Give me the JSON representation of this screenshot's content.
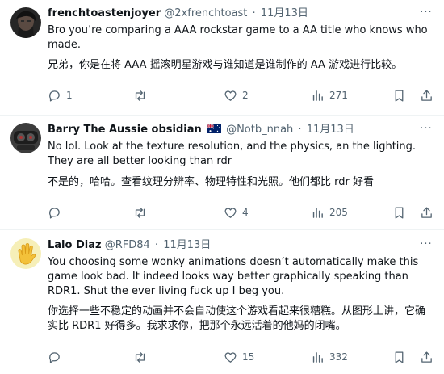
{
  "tweets": [
    {
      "name": "frenchtoastenjoyer",
      "handle": "@2xfrenchtoast",
      "separator": "·",
      "date": "11月13日",
      "more_label": "···",
      "text_en": "Bro you’re comparing a AAA rockstar game to a AA title who knows who made.",
      "text_zh": "兄弟，你是在将 AAA 摇滚明星游戏与谁知道是谁制作的 AA 游戏进行比较。",
      "replies": "1",
      "retweets": "",
      "likes": "2",
      "views": "271"
    },
    {
      "name": "Barry The Aussie obsidian",
      "flag": "australia-flag",
      "handle": "@Notb_nnah",
      "separator": "·",
      "date": "11月13日",
      "more_label": "···",
      "text_en": "No lol. Look at the texture resolution, and the physics, an the lighting. They are all better looking than rdr",
      "text_zh": "不是的，哈哈。查看纹理分辨率、物理特性和光照。他们都比 rdr 好看",
      "replies": "",
      "retweets": "",
      "likes": "4",
      "views": "205"
    },
    {
      "name": "Lalo Diaz",
      "handle": "@RFD84",
      "separator": "·",
      "date": "11月13日",
      "more_label": "···",
      "text_en": "You choosing some wonky animations doesn’t automatically make this game look bad. It indeed looks way better graphically speaking than RDR1. Shut the ever living fuck up I beg you.",
      "text_zh": "你选择一些不稳定的动画并不会自动使这个游戏看起来很糟糕。从图形上讲，它确实比 RDR1 好得多。我求求你，把那个永远活着的他妈的闭嘴。",
      "replies": "",
      "retweets": "",
      "likes": "15",
      "views": "332"
    }
  ],
  "icons": {
    "reply": "reply-icon",
    "retweet": "retweet-icon",
    "like": "heart-icon",
    "views": "views-icon",
    "bookmark": "bookmark-icon",
    "share": "share-icon"
  },
  "colors": {
    "text": "#0f1419",
    "secondary": "#536471",
    "divider": "#eff3f4",
    "avatar3_bg": "#f6efb8"
  }
}
